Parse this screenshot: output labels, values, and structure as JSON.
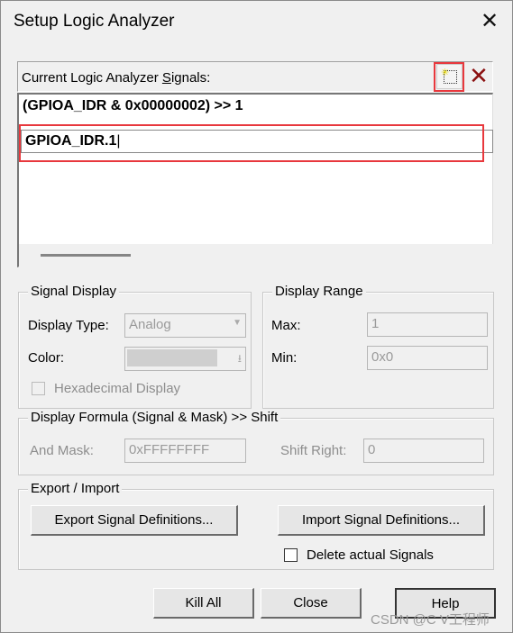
{
  "window": {
    "title": "Setup Logic Analyzer",
    "close_glyph": "✕"
  },
  "signals": {
    "label_pre": "Current Logic Analyzer ",
    "label_ul": "S",
    "label_post": "ignals:",
    "items": [
      "(GPIOA_IDR & 0x00000002) >> 1"
    ],
    "editing_value": "GPIOA_IDR.1"
  },
  "signal_display": {
    "title": "Signal Display",
    "display_type_label": "Display Type:",
    "display_type_value": "Analog",
    "color_label": "Color:",
    "hex_label": "Hexadecimal Display"
  },
  "display_range": {
    "title": "Display Range",
    "max_label": "Max:",
    "max_value": "1",
    "min_label": "Min:",
    "min_value": "0x0"
  },
  "formula": {
    "title": "Display Formula (Signal & Mask) >> Shift",
    "mask_label": "And Mask:",
    "mask_value": "0xFFFFFFFF",
    "shift_label": "Shift Right:",
    "shift_value": "0"
  },
  "export": {
    "title": "Export / Import",
    "export_btn": "Export Signal Definitions...",
    "import_btn": "Import Signal Definitions...",
    "delete_label": "Delete actual Signals"
  },
  "buttons": {
    "kill_all": "Kill All",
    "close": "Close",
    "help": "Help"
  },
  "watermark": "CSDN @C V工程师",
  "colors": {
    "highlight": "#e8383d",
    "delete_icon": "#8b1010"
  }
}
